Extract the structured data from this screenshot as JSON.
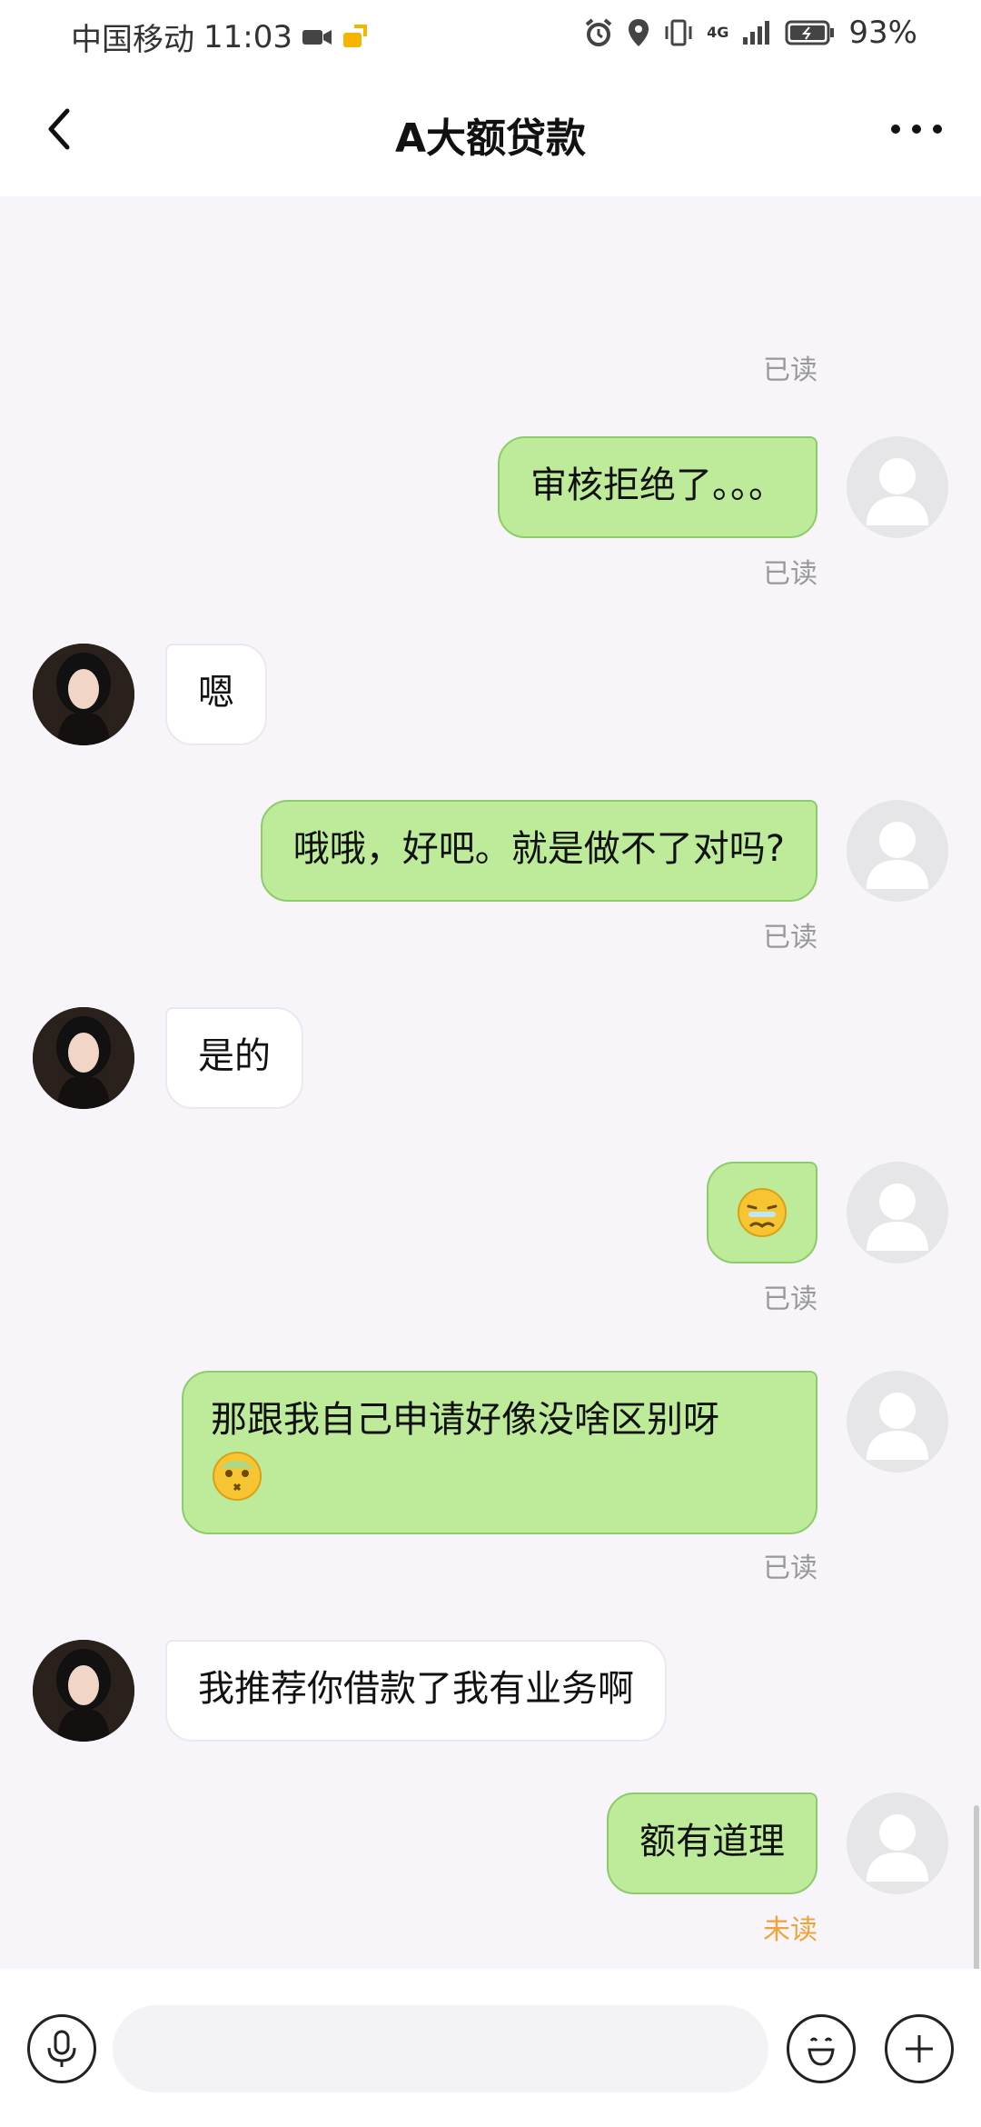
{
  "status_bar": {
    "carrier": "中国移动",
    "time": "11:03",
    "battery": "93%",
    "network": "4G"
  },
  "header": {
    "title": "A大额贷款"
  },
  "messages": [
    {
      "from": "me",
      "text": "审核拒绝了。。。",
      "status": "已读"
    },
    {
      "from": "other",
      "text": "嗯"
    },
    {
      "from": "me",
      "text": "哦哦，好吧。就是做不了对吗?",
      "status": "已读"
    },
    {
      "from": "other",
      "text": "是的"
    },
    {
      "from": "me",
      "emoji": "worried-face-emoji",
      "status": "已读"
    },
    {
      "from": "me",
      "text": "那跟我自己申请好像没啥区别呀",
      "emoji": "dizzy-face-emoji",
      "status": "已读"
    },
    {
      "from": "other",
      "text": "我推荐你借款了我有业务啊"
    },
    {
      "from": "me",
      "text": "额有道理",
      "status": "未读"
    }
  ],
  "top_status": "已读",
  "input": {
    "placeholder": ""
  },
  "colors": {
    "my_bubble": "#bdeb9a",
    "other_bubble": "#ffffff",
    "unread": "#f1a23a",
    "read": "#999999"
  }
}
